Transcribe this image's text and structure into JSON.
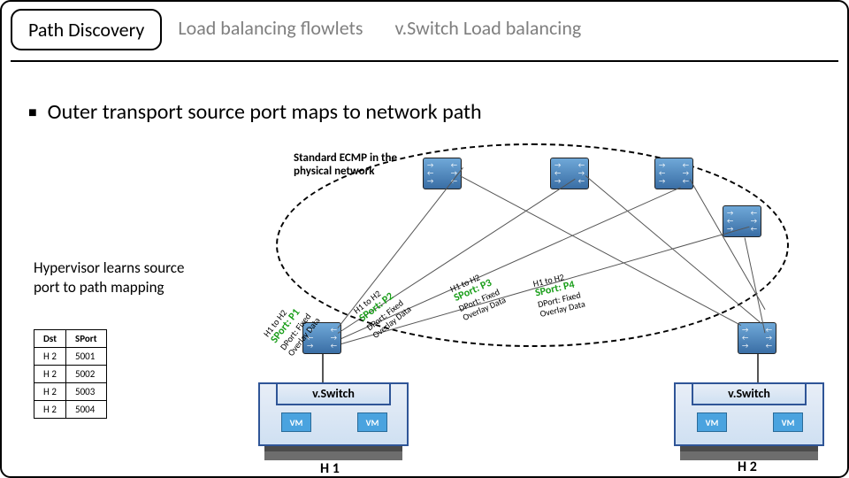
{
  "tabs": {
    "t1": "Path Discovery",
    "t2": "Load balancing flowlets",
    "t3": "v.Switch Load balancing"
  },
  "bullet": "Outer transport source port maps to network path",
  "hv_text": "Hypervisor learns source port to path mapping",
  "table": {
    "h_dst": "Dst",
    "h_sport": "SPort",
    "rows": [
      {
        "dst": "H 2",
        "sport": "5001"
      },
      {
        "dst": "H 2",
        "sport": "5002"
      },
      {
        "dst": "H 2",
        "sport": "5003"
      },
      {
        "dst": "H 2",
        "sport": "5004"
      }
    ]
  },
  "ecmp": "Standard ECMP in the physical network",
  "hosts": {
    "vs_label": "v.Switch",
    "vm_label": "VM",
    "h1": "H 1",
    "h2": "H 2"
  },
  "packets": {
    "p1": {
      "l1": "H1 to H2",
      "sp": "SPort: P1",
      "l3": "DPort: Fixed",
      "l4": "Overlay Data"
    },
    "p2": {
      "l1": "H1 to H2",
      "sp": "SPort: P2",
      "l3": "DPort: Fixed",
      "l4": "Overlay Data"
    },
    "p3": {
      "l1": "H1 to H2",
      "sp": "SPort: P3",
      "l3": "DPort: Fixed",
      "l4": "Overlay Data"
    },
    "p4": {
      "l1": "H1 to H2",
      "sp": "SPort: P4",
      "l3": "DPort: Fixed",
      "l4": "Overlay Data"
    }
  }
}
